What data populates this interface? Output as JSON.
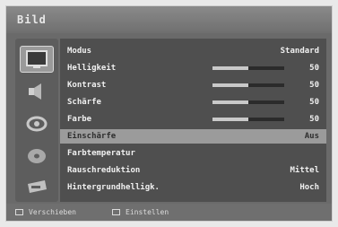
{
  "title": "Bild",
  "sidebar": {
    "items": [
      {
        "icon": "tv-picture-icon",
        "active": true
      },
      {
        "icon": "speaker-sound-icon",
        "active": false
      },
      {
        "icon": "satellite-dish-icon",
        "active": false
      },
      {
        "icon": "disc-settings-icon",
        "active": false
      },
      {
        "icon": "input-source-icon",
        "active": false
      }
    ]
  },
  "menu": {
    "rows": [
      {
        "label": "Modus",
        "value": "Standard"
      },
      {
        "label": "Helligkeit",
        "value": "50",
        "level": 0.5
      },
      {
        "label": "Kontrast",
        "value": "50",
        "level": 0.5
      },
      {
        "label": "Schärfe",
        "value": "50",
        "level": 0.5
      },
      {
        "label": "Farbe",
        "value": "50",
        "level": 0.5
      },
      {
        "label": "Einschärfe",
        "value": "Aus",
        "selected": true
      },
      {
        "label": "Farbtemperatur",
        "value": ""
      },
      {
        "label": "Rauschreduktion",
        "value": "Mittel"
      },
      {
        "label": "Hintergrundhelligk.",
        "value": "Hoch"
      }
    ]
  },
  "footer": {
    "hint_left": "Verschieben",
    "hint_right": "Einstellen"
  },
  "colors": {
    "panel": "#4f4f4f",
    "highlight": "#9b9b9b",
    "text": "#f0f0f0"
  }
}
